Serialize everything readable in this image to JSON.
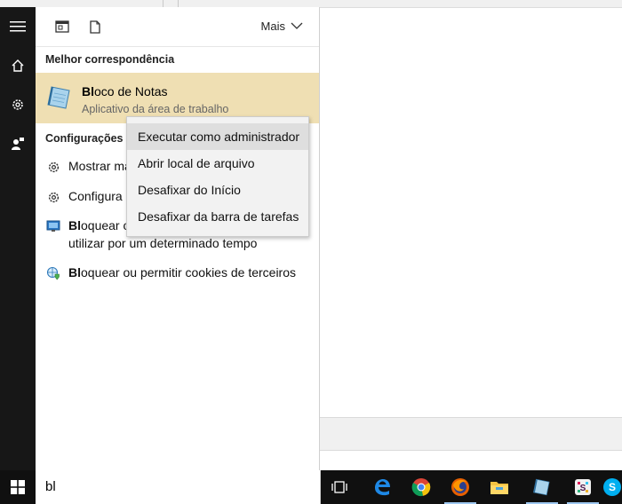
{
  "taskbar_search": {
    "query": "bl"
  },
  "panel": {
    "more_label": "Mais",
    "best_match_header": "Melhor correspondência",
    "best_match": {
      "title_bold": "Bl",
      "title_rest": "oco de Notas",
      "subtitle": "Aplicativo da área de trabalho"
    },
    "settings_header": "Configurações",
    "settings_items": [
      {
        "bold": "",
        "text": "Mostrar ma",
        "icon": "gear-icon"
      },
      {
        "bold": "",
        "text": "Configura",
        "icon": "gear-icon"
      },
      {
        "bold": "Bl",
        "line1": "oquear o",
        "line2": "utilizar por um determinado tempo",
        "icon": "screen-icon"
      },
      {
        "bold": "Bl",
        "text": "oquear ou permitir cookies de terceiros",
        "icon": "globe-shield-icon"
      }
    ]
  },
  "context_menu": {
    "items": [
      "Executar como administrador",
      "Abrir local de arquivo",
      "Desafixar do Início",
      "Desafixar da barra de tarefas"
    ],
    "hovered_index": 0
  },
  "taskbar": {
    "apps": [
      "task-view-icon",
      "edge-icon",
      "chrome-icon",
      "firefox-icon",
      "file-explorer-icon",
      "notepad-icon",
      "slack-icon",
      "skype-icon"
    ]
  },
  "colors": {
    "best_match_bg": "#efdfb3",
    "rail_bg": "#171717",
    "taskbar_bg": "#101010",
    "menu_hover": "#dedede"
  }
}
